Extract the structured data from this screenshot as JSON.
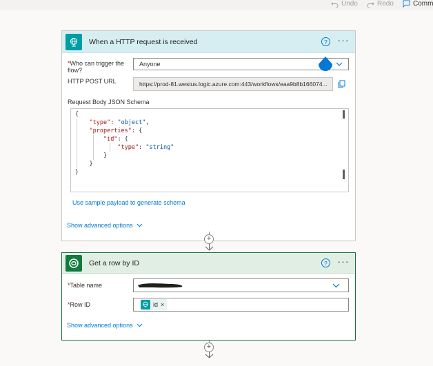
{
  "toolbar": {
    "undo_label": "Undo",
    "redo_label": "Redo",
    "comments_label": "Comm"
  },
  "trigger_card": {
    "title": "When a HTTP request is received",
    "help_glyph": "?",
    "more_glyph": "···",
    "who_label_line1": "Who can trigger the",
    "who_label_line2": "flow?",
    "who_value": "Anyone",
    "url_label": "HTTP POST URL",
    "url_value": "https://prod-81.westus.logic.azure.com:443/workflows/eaa9b8b166074...",
    "schema_label": "Request Body JSON Schema",
    "schema_lines": [
      "{",
      "    \"type\": \"object\",",
      "    \"properties\": {",
      "        \"id\": {",
      "            \"type\": \"string\"",
      "        }",
      "    }",
      "}"
    ],
    "sample_link": "Use sample payload to generate schema",
    "advanced_label": "Show advanced options",
    "required_mark": "*",
    "header_color": "#d6eef2",
    "icon_color": "#009da5"
  },
  "action_card": {
    "title": "Get a row by ID",
    "help_glyph": "?",
    "more_glyph": "···",
    "table_label": "Table name",
    "row_label": "Row ID",
    "row_chip": "id",
    "chip_close": "×",
    "advanced_label": "Show advanced options",
    "required_mark": "*",
    "header_color": "#e0eee4",
    "icon_color": "#137a3f"
  },
  "connector": {
    "plus_glyph": "+"
  },
  "icons": [
    "undo-icon",
    "redo-icon",
    "comment-icon",
    "globe-icon",
    "dataverse-icon",
    "help-icon",
    "more-icon",
    "chevron-down-icon",
    "copy-icon",
    "plus-icon",
    "arrow-down-icon",
    "close-icon"
  ]
}
